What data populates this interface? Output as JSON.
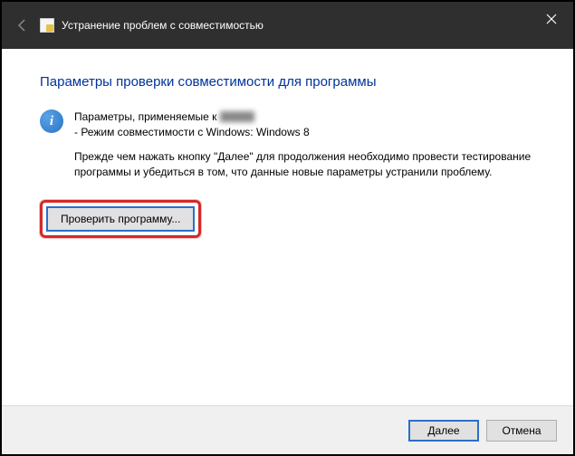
{
  "window": {
    "title": "Устранение проблем с совместимостью"
  },
  "main": {
    "heading": "Параметры проверки совместимости для программы",
    "info_line1_prefix": "Параметры, применяемые к",
    "info_line2": "- Режим совместимости с Windows: Windows 8",
    "instruction": "Прежде чем нажать кнопку \"Далее\" для продолжения необходимо провести тестирование программы и убедиться в том, что данные новые параметры устранили проблему.",
    "test_button": "Проверить программу..."
  },
  "footer": {
    "next": "Далее",
    "cancel": "Отмена"
  }
}
